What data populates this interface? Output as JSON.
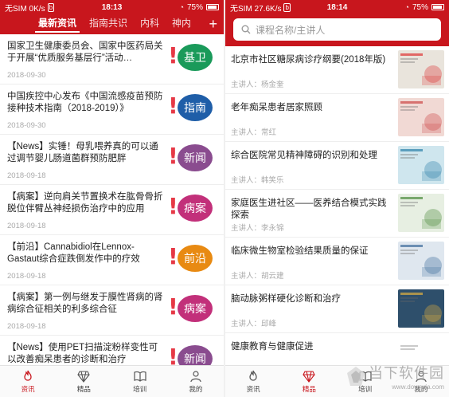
{
  "left": {
    "status": {
      "carrier": "无SIM 0K/s",
      "app_badge": "b",
      "time": "18:13",
      "battery": "75%"
    },
    "tabs": [
      "最新资讯",
      "指南共识",
      "内科",
      "神内"
    ],
    "add_label": "+",
    "news": [
      {
        "title": "国家卫生健康委员会、国家中医药局关于开展“优质服务基层行”活动…",
        "date": "2018-09-30",
        "tag": "基卫",
        "tag_color": "#1a9a5a",
        "excl_color": "#e63946"
      },
      {
        "title": "中国疾控中心发布《中国流感疫苗预防接种技术指南（2018-2019）》",
        "date": "2018-09-30",
        "tag": "指南",
        "tag_color": "#1f5ea8",
        "excl_color": "#e63946"
      },
      {
        "title": "【News】实锤！母乳喂养真的可以通过调节婴儿肠道菌群预防肥胖",
        "date": "2018-09-18",
        "tag": "新闻",
        "tag_color": "#8a4c8f",
        "excl_color": "#e63946"
      },
      {
        "title": "【病案】逆向肩关节置换术在肱骨骨折脱位伴臂丛神经损伤治疗中的应用",
        "date": "2018-09-18",
        "tag": "病案",
        "tag_color": "#c2307a",
        "excl_color": "#e63946"
      },
      {
        "title": "【前沿】Cannabidiol在Lennox-Gastaut综合症跌倒发作中的疗效",
        "date": "2018-09-18",
        "tag": "前沿",
        "tag_color": "#e88a12",
        "excl_color": "#e63946"
      },
      {
        "title": "【病案】第一例与继发于膜性肾病的肾病综合征相关的利多综合征",
        "date": "2018-09-18",
        "tag": "病案",
        "tag_color": "#c2307a",
        "excl_color": "#e63946"
      },
      {
        "title": "【News】使用PET扫描淀粉样变性可以改善痴呆患者的诊断和治疗",
        "date": "",
        "tag": "新闻",
        "tag_color": "#8a4c8f",
        "excl_color": "#e63946"
      }
    ],
    "nav": [
      {
        "label": "资讯",
        "icon": "fire-icon",
        "active": true
      },
      {
        "label": "精品",
        "icon": "diamond-icon",
        "active": false
      },
      {
        "label": "培训",
        "icon": "book-icon",
        "active": false
      },
      {
        "label": "我的",
        "icon": "user-icon",
        "active": false
      }
    ]
  },
  "right": {
    "status": {
      "carrier": "无SIM 27.6K/s",
      "app_badge": "b",
      "time": "18:14",
      "battery": "75%"
    },
    "search_placeholder": "课程名称/主讲人",
    "courses": [
      {
        "title": "北京市社区糖尿病诊疗纲要(2018年版)",
        "lecturer": "主讲人：杨金奎",
        "thumb_bg": "#e9e4dc",
        "thumb_accent": "#d33"
      },
      {
        "title": "老年痴呆患者居家照顾",
        "lecturer": "主讲人：常红",
        "thumb_bg": "#f1d9d4",
        "thumb_accent": "#c44"
      },
      {
        "title": "综合医院常见精神障碍的识别和处理",
        "lecturer": "主讲人：韩笑乐",
        "thumb_bg": "#cfe6ee",
        "thumb_accent": "#2a7fa8"
      },
      {
        "title": "家庭医生进社区——医养结合模式实践探索",
        "lecturer": "主讲人：李永锦",
        "thumb_bg": "#e7efe2",
        "thumb_accent": "#4a8a3a"
      },
      {
        "title": "临床微生物室检验结果质量的保证",
        "lecturer": "主讲人：胡云建",
        "thumb_bg": "#dfe7ef",
        "thumb_accent": "#3a6a9a"
      },
      {
        "title": "脑动脉粥样硬化诊断和治疗",
        "lecturer": "主讲人：邱峰",
        "thumb_bg": "#2e4f6b",
        "thumb_accent": "#e0b040"
      },
      {
        "title": "健康教育与健康促进",
        "lecturer": "",
        "thumb_bg": "#ffffff",
        "thumb_accent": "#ffffff"
      }
    ],
    "nav": [
      {
        "label": "资讯",
        "icon": "fire-icon",
        "active": false
      },
      {
        "label": "精品",
        "icon": "diamond-icon",
        "active": true
      },
      {
        "label": "培训",
        "icon": "book-icon",
        "active": false
      },
      {
        "label": "我的",
        "icon": "user-icon",
        "active": false
      }
    ],
    "watermark": {
      "text": "当下软件园",
      "url": "www.downxia.com"
    }
  },
  "colors": {
    "brand_red": "#c8161d"
  }
}
